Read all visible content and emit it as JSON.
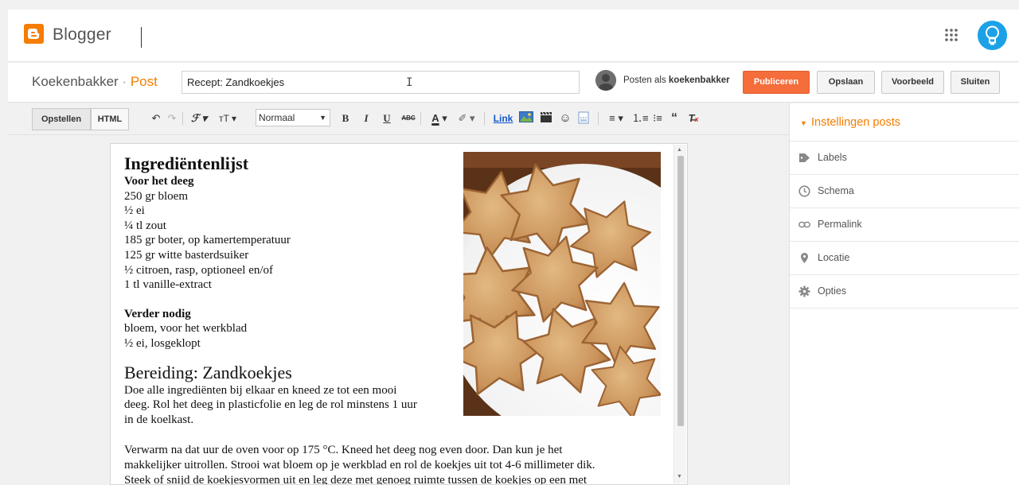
{
  "app": {
    "brand": "Blogger",
    "accent_color": "#f57d00",
    "icons": {
      "logo": "blogger-logo-icon",
      "apps": "apps-grid-icon",
      "account": "account-avatar-icon"
    }
  },
  "post_header": {
    "blog_name": "Koekenbakker",
    "separator": "·",
    "section": "Post",
    "title_value": "Recept: Zandkoekjes",
    "posting_as_prefix": "Posten als",
    "posting_as_user": "koekenbakker",
    "buttons": {
      "publish": "Publiceren",
      "save": "Opslaan",
      "preview": "Voorbeeld",
      "close": "Sluiten"
    }
  },
  "toolbar": {
    "compose_label": "Opstellen",
    "html_label": "HTML",
    "format_value": "Normaal",
    "link_label": "Link",
    "icons": [
      "undo-icon",
      "redo-icon",
      "font-family-icon",
      "font-size-icon",
      "bold-icon",
      "italic-icon",
      "underline-icon",
      "strikethrough-icon",
      "text-color-icon",
      "highlight-icon",
      "link-icon",
      "image-icon",
      "video-icon",
      "emoji-icon",
      "jump-break-icon",
      "align-icon",
      "numbered-list-icon",
      "bulleted-list-icon",
      "quote-icon",
      "clear-format-icon"
    ]
  },
  "content": {
    "heading1": "Ingrediëntenlijst",
    "dough_heading": "Voor het deeg",
    "dough_items": [
      "250 gr bloem",
      "½ ei",
      "¼ tl zout",
      "185 gr boter, op kamertemperatuur",
      "125 gr witte basterdsuiker",
      "½ citroen, rasp, optioneel en/of",
      "1 tl vanille-extract"
    ],
    "extra_heading": "Verder nodig",
    "extra_items": [
      "bloem, voor het werkblad",
      "½ ei, losgeklopt"
    ],
    "heading2": "Bereiding: Zandkoekjes",
    "para1_lines": [
      "Doe alle ingrediënten bij elkaar en kneed ze tot een mooi",
      "deeg. Rol het deeg in plasticfolie en leg de rol minstens 1 uur",
      "in de koelkast."
    ],
    "para2_lines": [
      "Verwarm na dat uur de oven voor op 175 °C. Kneed het deeg nog even door. Dan kun je het",
      "makkelijker uitrollen. Strooi wat bloem op je werkblad en rol de koekjes uit tot 4-6 millimeter dik.",
      "Steek of snijd de koekjesvormen uit en leg deze met genoeg ruimte tussen de koekjes op een met"
    ],
    "image": "star-shaped-cookies-photo"
  },
  "sidebar": {
    "header": "Instellingen posts",
    "items": [
      {
        "label": "Labels",
        "icon": "label-tag-icon"
      },
      {
        "label": "Schema",
        "icon": "clock-icon"
      },
      {
        "label": "Permalink",
        "icon": "link-chain-icon"
      },
      {
        "label": "Locatie",
        "icon": "location-pin-icon"
      },
      {
        "label": "Opties",
        "icon": "gear-icon"
      }
    ]
  }
}
